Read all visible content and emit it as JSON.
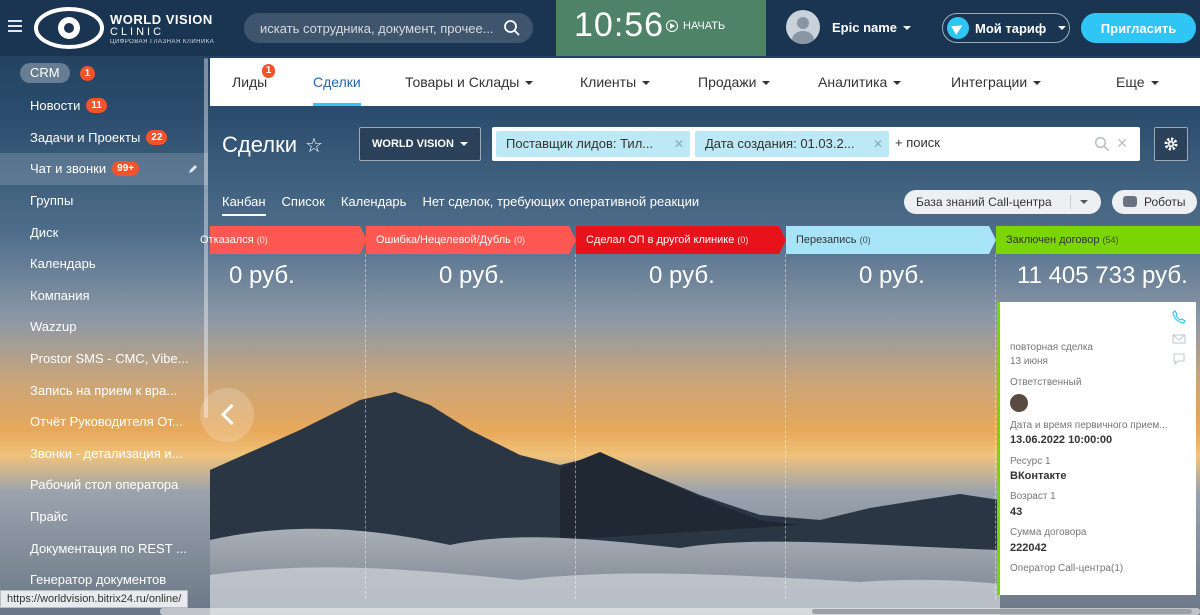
{
  "brand": {
    "line1": "WORLD VISION",
    "line2": "CLINIC",
    "line3": "ЦИФРОВАЯ ГЛАЗНАЯ КЛИНИКА"
  },
  "search": {
    "placeholder": "искать сотрудника, документ, прочее..."
  },
  "clock": {
    "time": "10:56",
    "start_label": "НАЧАТЬ"
  },
  "user": {
    "name": "Epic name"
  },
  "tariff": {
    "label": "Мой тариф"
  },
  "invite": {
    "label": "Пригласить"
  },
  "sidebar": {
    "items": [
      {
        "label": "CRM",
        "badge": "1"
      },
      {
        "label": "Новости",
        "badge": "11"
      },
      {
        "label": "Задачи и Проекты",
        "badge": "22"
      },
      {
        "label": "Чат и звонки",
        "badge": "99+"
      },
      {
        "label": "Группы"
      },
      {
        "label": "Диск"
      },
      {
        "label": "Календарь"
      },
      {
        "label": "Компания"
      },
      {
        "label": "Wazzup"
      },
      {
        "label": "Prostor SMS - СМС, Vibe..."
      },
      {
        "label": "Запись на прием к вра..."
      },
      {
        "label": "Отчёт Руководителя От..."
      },
      {
        "label": "Звонки - детализация и..."
      },
      {
        "label": "Рабочий стол оператора"
      },
      {
        "label": "Прайс"
      },
      {
        "label": "Документация по REST ..."
      },
      {
        "label": "Генератор документов"
      }
    ]
  },
  "status_url": "https://worldvision.bitrix24.ru/online/",
  "nav": {
    "tabs": [
      {
        "label": "Лиды",
        "badge": "1"
      },
      {
        "label": "Сделки"
      },
      {
        "label": "Товары и Склады"
      },
      {
        "label": "Клиенты"
      },
      {
        "label": "Продажи"
      },
      {
        "label": "Аналитика"
      },
      {
        "label": "Интеграции"
      },
      {
        "label": "Еще"
      }
    ]
  },
  "page": {
    "title": "Сделки",
    "category_button": "WORLD VISION",
    "filter_chip_1": "Поставщик лидов: Тил...",
    "filter_chip_2": "Дата создания: 01.03.2...",
    "search_label": "+ поиск"
  },
  "views": {
    "items": [
      "Канбан",
      "Список",
      "Календарь",
      "Нет сделок, требующих оперативной реакции"
    ],
    "knowledge_button": "База знаний Call-центра",
    "robots_button": "Роботы"
  },
  "stages": [
    {
      "name": "Отказался",
      "count": "(0)",
      "sum": "0 руб.",
      "color": "#ff5752"
    },
    {
      "name": "Ошибка/Нецелевой/Дубль",
      "count": "(0)",
      "sum": "0 руб.",
      "color": "#ff5752"
    },
    {
      "name": "Сделал ОП в другой клинике",
      "count": "(0)",
      "sum": "0 руб.",
      "color": "#e8131a"
    },
    {
      "name": "Перезапись",
      "count": "(0)",
      "sum": "0 руб.",
      "color": "#a8e4f8"
    },
    {
      "name": "Заключен договор",
      "count": "(54)",
      "sum": "11 405 733 руб.",
      "color": "#7bd500"
    }
  ],
  "card": {
    "subtitle": "повторная сделка",
    "date": "13 июня",
    "responsible_label": "Ответственный",
    "datetime_label": "Дата и время первичного прием...",
    "datetime_value": "13.06.2022 10:00:00",
    "resource_label": "Ресурс 1",
    "resource_value": "ВКонтакте",
    "age_label": "Возраст 1",
    "age_value": "43",
    "sum_label": "Сумма договора",
    "sum_value": "222042",
    "operator_label": "Оператор Call-центра(1)"
  }
}
